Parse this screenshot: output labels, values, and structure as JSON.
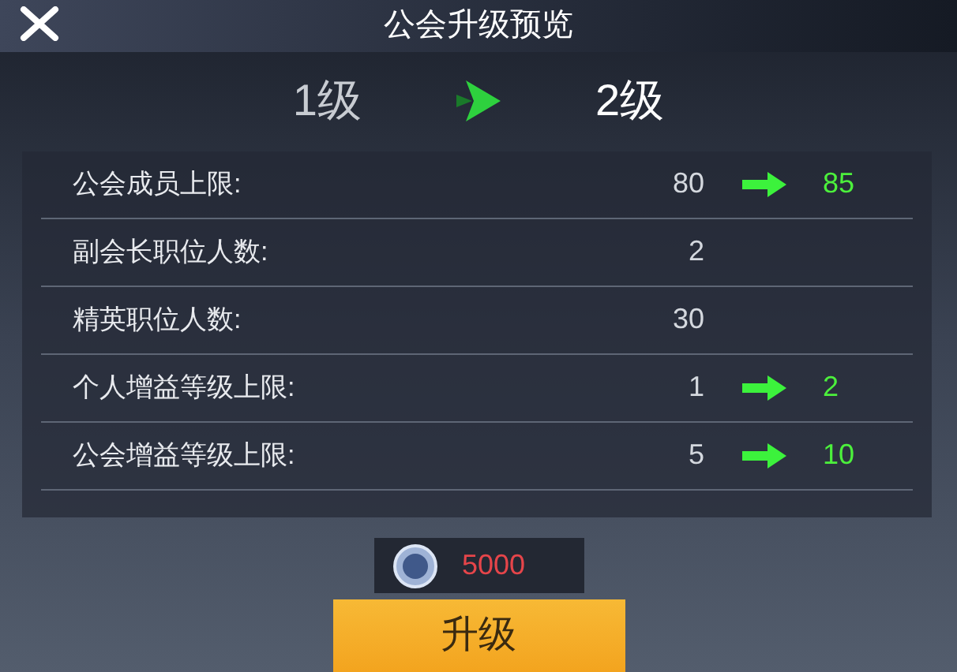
{
  "window": {
    "title": "公会升级预览"
  },
  "levels": {
    "from": "1级",
    "to": "2级"
  },
  "rows": [
    {
      "label": "公会成员上限:",
      "current": "80",
      "next": "85"
    },
    {
      "label": "副会长职位人数:",
      "current": "2"
    },
    {
      "label": "精英职位人数:",
      "current": "30"
    },
    {
      "label": "个人增益等级上限:",
      "current": "1",
      "next": "2"
    },
    {
      "label": "公会增益等级上限:",
      "current": "5",
      "next": "10"
    }
  ],
  "cost": {
    "amount": "5000"
  },
  "button": "升级"
}
